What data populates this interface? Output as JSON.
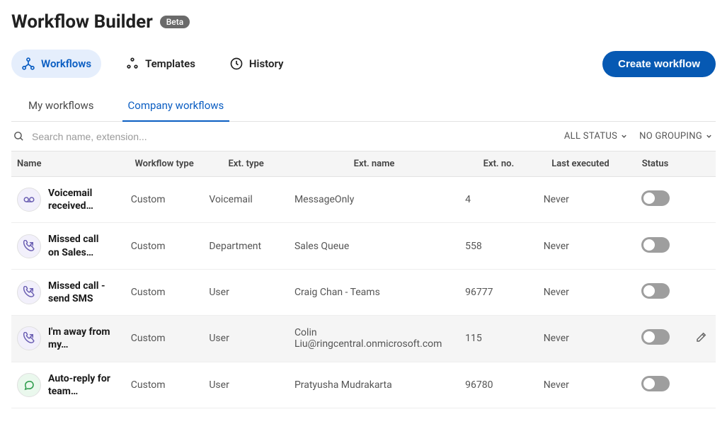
{
  "header": {
    "title": "Workflow Builder",
    "badge": "Beta"
  },
  "nav": {
    "workflows": "Workflows",
    "templates": "Templates",
    "history": "History",
    "create_btn": "Create workflow"
  },
  "sub_tabs": {
    "my": "My workflows",
    "company": "Company workflows"
  },
  "search": {
    "placeholder": "Search name, extension..."
  },
  "filters": {
    "status": "ALL STATUS",
    "grouping": "NO GROUPING"
  },
  "columns": {
    "name": "Name",
    "wf_type": "Workflow type",
    "ext_type": "Ext. type",
    "ext_name": "Ext. name",
    "ext_no": "Ext. no.",
    "last_exec": "Last executed",
    "status": "Status"
  },
  "rows": [
    {
      "icon": "voicemail",
      "icon_color": "purple",
      "name": "Voicemail received…",
      "wf_type": "Custom",
      "ext_type": "Voicemail",
      "ext_name": "MessageOnly",
      "ext_no": "4",
      "last_exec": "Never",
      "status_on": false,
      "hover": false
    },
    {
      "icon": "missed-call",
      "icon_color": "purple",
      "name": "Missed call on Sales…",
      "wf_type": "Custom",
      "ext_type": "Department",
      "ext_name": "Sales Queue",
      "ext_no": "558",
      "last_exec": "Never",
      "status_on": false,
      "hover": false
    },
    {
      "icon": "missed-call",
      "icon_color": "purple",
      "name": "Missed call - send SMS",
      "wf_type": "Custom",
      "ext_type": "User",
      "ext_name": "Craig Chan - Teams",
      "ext_no": "96777",
      "last_exec": "Never",
      "status_on": false,
      "hover": false
    },
    {
      "icon": "missed-call",
      "icon_color": "purple",
      "name": "I'm away from my…",
      "wf_type": "Custom",
      "ext_type": "User",
      "ext_name": "Colin Liu@ringcentral.onmicrosoft.com",
      "ext_no": "115",
      "last_exec": "Never",
      "status_on": false,
      "hover": true
    },
    {
      "icon": "chat",
      "icon_color": "green",
      "name": "Auto-reply for team…",
      "wf_type": "Custom",
      "ext_type": "User",
      "ext_name": "Pratyusha Mudrakarta",
      "ext_no": "96780",
      "last_exec": "Never",
      "status_on": false,
      "hover": false
    }
  ]
}
